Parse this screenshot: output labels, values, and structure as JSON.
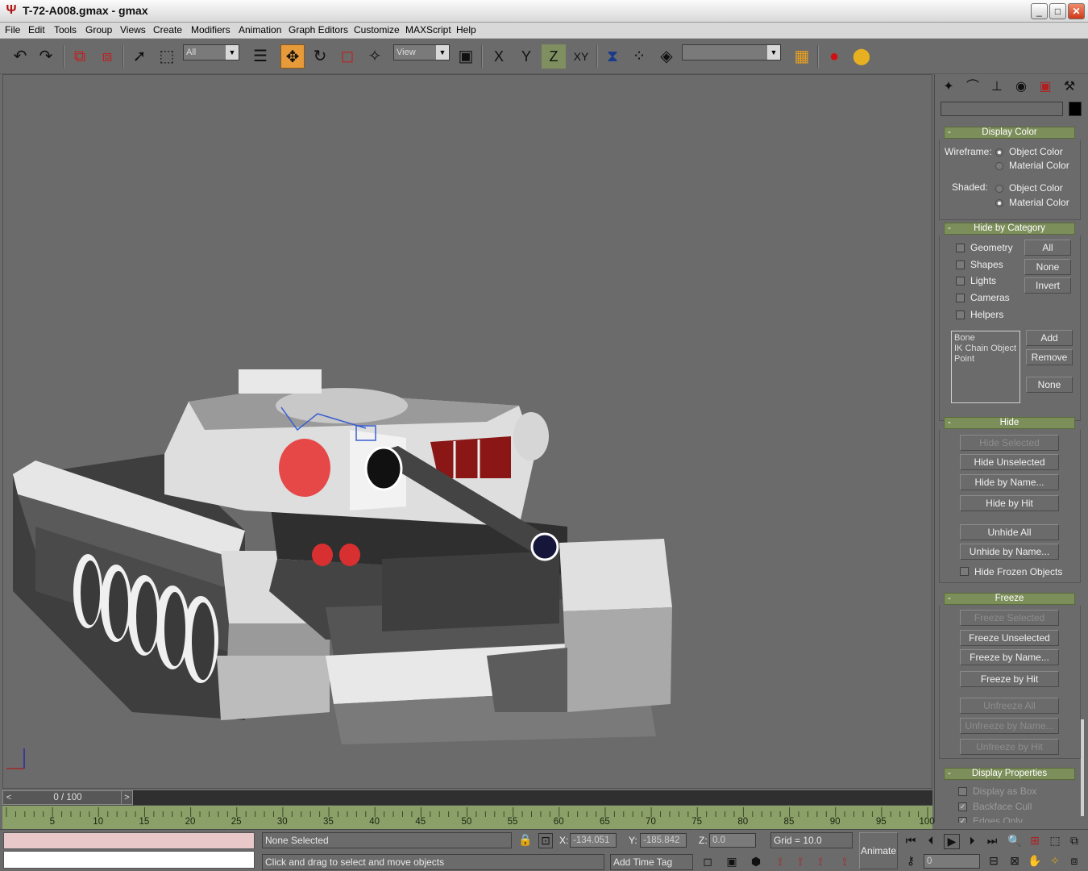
{
  "window": {
    "title": "T-72-A008.gmax - gmax",
    "minimize": "_",
    "maximize": "□",
    "close": "✕"
  },
  "menu": [
    "File",
    "Edit",
    "Tools",
    "Group",
    "Views",
    "Create",
    "Modifiers",
    "Animation",
    "Graph Editors",
    "Customize",
    "MAXScript",
    "Help"
  ],
  "toolbar": {
    "selection_filter": "All",
    "ref_coord": "View",
    "axis_x": "X",
    "axis_y": "Y",
    "axis_z": "Z",
    "axis_xy": "XY",
    "named_selection": "",
    "icons": [
      "undo-icon",
      "redo-icon",
      "select-link-icon",
      "unlink-icon",
      "select-arrow-icon",
      "region-select-icon",
      "select-by-name-icon",
      "move-icon",
      "rotate-icon",
      "scale-icon",
      "manipulate-icon",
      "use-pivot-icon",
      "mirror-icon",
      "array-icon",
      "align-icon",
      "layers-icon",
      "render-icon",
      "material-icon"
    ]
  },
  "command_panel": {
    "tab_icons": [
      "create-icon",
      "modify-icon",
      "hierarchy-icon",
      "motion-icon",
      "display-icon",
      "utilities-icon"
    ],
    "display_color": {
      "header": "Display Color",
      "wireframe_label": "Wireframe:",
      "shaded_label": "Shaded:",
      "object_color": "Object Color",
      "material_color": "Material Color",
      "wireframe_selected": "Object Color",
      "shaded_selected": "Material Color"
    },
    "hide_by_category": {
      "header": "Hide by Category",
      "checks": [
        "Geometry",
        "Shapes",
        "Lights",
        "Cameras",
        "Helpers"
      ],
      "buttons": [
        "All",
        "None",
        "Invert"
      ],
      "list": [
        "Bone",
        "IK Chain Object",
        "Point"
      ],
      "list_buttons": [
        "Add",
        "Remove",
        "None"
      ]
    },
    "hide": {
      "header": "Hide",
      "hide_selected": "Hide Selected",
      "hide_unselected": "Hide Unselected",
      "hide_by_name": "Hide by Name...",
      "hide_by_hit": "Hide by Hit",
      "unhide_all": "Unhide All",
      "unhide_by_name": "Unhide by Name...",
      "hide_frozen": "Hide Frozen Objects"
    },
    "freeze": {
      "header": "Freeze",
      "freeze_selected": "Freeze Selected",
      "freeze_unselected": "Freeze Unselected",
      "freeze_by_name": "Freeze by Name...",
      "freeze_by_hit": "Freeze by Hit",
      "unfreeze_all": "Unfreeze All",
      "unfreeze_by_name": "Unfreeze by Name...",
      "unfreeze_by_hit": "Unfreeze by Hit"
    },
    "display_properties": {
      "header": "Display Properties",
      "display_as_box": "Display as Box",
      "backface_cull": "Backface Cull",
      "edges_only": "Edges Only"
    }
  },
  "timeline": {
    "frame_display": "0 / 100",
    "prev": "<",
    "next": ">",
    "ticks": [
      "5",
      "10",
      "15",
      "20",
      "25",
      "30",
      "35",
      "40",
      "45",
      "50",
      "55",
      "60",
      "65",
      "70",
      "75",
      "80",
      "85",
      "90",
      "95",
      "100"
    ]
  },
  "status": {
    "selection": "None Selected",
    "prompt": "Click and drag to select and move objects",
    "x_label": "X:",
    "x_value": "-134.051",
    "y_label": "Y:",
    "y_value": "-185.842",
    "z_label": "Z:",
    "z_value": "0.0",
    "grid": "Grid = 10.0",
    "add_time_tag": "Add Time Tag",
    "animate": "Animate",
    "current_frame": "0"
  },
  "colors": {
    "accent_active": "#e79a3a",
    "rollout_header": "#7c8e5a",
    "viewport_bg": "#6b6b6b",
    "trackbar": "#8aa068",
    "red_marking": "#e64848"
  }
}
